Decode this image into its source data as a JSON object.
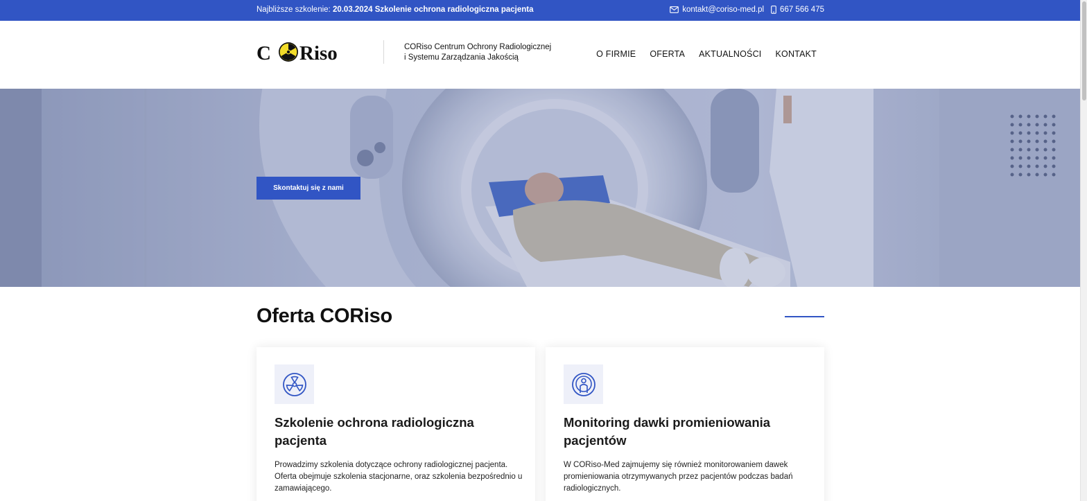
{
  "topbar": {
    "next_training_prefix": "Najbliższe szkolenie: ",
    "next_training_date": "20.03.2024",
    "next_training_title": "Szkolenie ochrona radiologiczna pacjenta",
    "email": "kontakt@coriso-med.pl",
    "phone": "667 566 475",
    "color": "#3155c4"
  },
  "header": {
    "logo_text": "CORiso",
    "tagline_line1": "CORiso Centrum Ochrony Radiologicznej",
    "tagline_line2": "i Systemu Zarządzania Jakością",
    "nav": [
      "O FIRMIE",
      "OFERTA",
      "AKTUALNOŚCI",
      "KONTAKT"
    ]
  },
  "hero": {
    "cta_label": "Skontaktuj się z nami"
  },
  "offer": {
    "title": "Oferta CORiso",
    "cards": [
      {
        "icon": "radiation-icon",
        "title": "Szkolenie ochrona radiologiczna pacjenta",
        "text": "Prowadzimy szkolenia dotyczące ochrony radiologicznej pacjenta. Oferta obejmuje szkolenia stacjonarne, oraz szkolenia bezpośrednio u zamawiającego."
      },
      {
        "icon": "patient-scan-icon",
        "title": "Monitoring dawki promieniowania pacjentów",
        "text": "W CORiso-Med zajmujemy się również monitorowaniem dawek promieniowania otrzymywanych przez pacjentów podczas badań radiologicznych."
      }
    ]
  }
}
